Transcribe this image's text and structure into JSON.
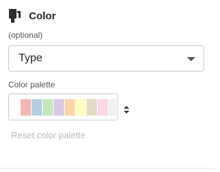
{
  "section": {
    "title": "Color",
    "icon": "paint-bucket-icon"
  },
  "type_field": {
    "label": "(optional)",
    "value": "Type"
  },
  "palette": {
    "label": "Color palette",
    "colors": [
      "#f4b6b0",
      "#b3cde3",
      "#c6e6b9",
      "#d9c6e4",
      "#fdd4aa",
      "#fffec0",
      "#e6dac4",
      "#fcd7e6",
      "#f0f0f0"
    ],
    "reset_label": "Reset color palette"
  }
}
